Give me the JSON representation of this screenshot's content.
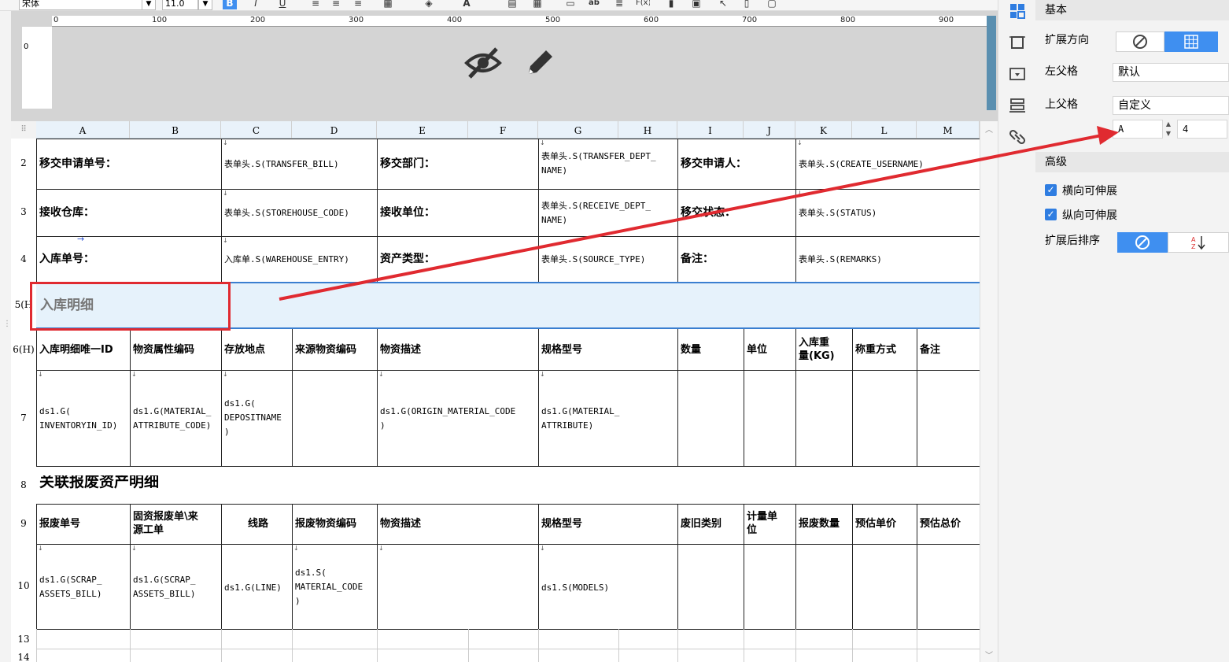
{
  "toolbar": {
    "font_name": "宋体",
    "font_size": "11.0"
  },
  "ruler": {
    "vertical_zero": "0",
    "marks": [
      "0",
      "100",
      "200",
      "300",
      "400",
      "500",
      "600",
      "700",
      "800",
      "900"
    ]
  },
  "grid": {
    "columns": [
      "A",
      "B",
      "C",
      "D",
      "E",
      "F",
      "G",
      "H",
      "I",
      "J",
      "K",
      "L",
      "M"
    ],
    "row_labels": [
      "2",
      "3",
      "4",
      "5(H",
      "6(H)",
      "7",
      "8",
      "9",
      "10",
      "13",
      "14"
    ],
    "rows": {
      "r2": {
        "a": "移交申请单号：",
        "c": "表单头.S(TRANSFER_BILL)",
        "e": "移交部门：",
        "g": "表单头.S(TRANSFER_DEPT_\nNAME)",
        "i": "移交申请人：",
        "k": "表单头.S(CREATE_USERNAME)"
      },
      "r3": {
        "a": "接收仓库：",
        "c": "表单头.S(STOREHOUSE_CODE)",
        "e": "接收单位：",
        "g": "表单头.S(RECEIVE_DEPT_\nNAME)",
        "i": "移交状态：",
        "k": "表单头.S(STATUS)"
      },
      "r4": {
        "a": "入库单号：",
        "c": "入库单.S(WAREHOUSE_ENTRY)",
        "e": "资产类型：",
        "g": "表单头.S(SOURCE_TYPE)",
        "i": "备注：",
        "k": "表单头.S(REMARKS)"
      },
      "r5": {
        "a": "入库明细"
      },
      "r6": [
        "入库明细唯一ID",
        "物资属性编码",
        "存放地点",
        "来源物资编码",
        "物资描述",
        "规格型号",
        "数量",
        "单位",
        "入库重\n量(KG)",
        "称重方式",
        "备注"
      ],
      "r7": {
        "a": "ds1.G(\nINVENTORYIN_ID)",
        "b": "ds1.G(MATERIAL_\nATTRIBUTE_CODE)",
        "c": "ds1.G(\nDEPOSITNAME\n)",
        "e": "ds1.G(ORIGIN_MATERIAL_CODE\n)",
        "g": "ds1.G(MATERIAL_\nATTRIBUTE)"
      },
      "r8": {
        "a": "关联报废资产明细"
      },
      "r9": [
        "报废单号",
        "固资报废单\\来\n源工单",
        "线路",
        "报废物资编码",
        "物资描述",
        "规格型号",
        "废旧类别",
        "计量单\n位",
        "报废数量",
        "预估单价",
        "预估总价"
      ],
      "r10": {
        "a": "ds1.G(SCRAP_\nASSETS_BILL)",
        "b": "ds1.G(SCRAP_\nASSETS_BILL)",
        "c": "ds1.G(LINE)",
        "d": "ds1.S(\nMATERIAL_CODE\n)",
        "g": "ds1.S(MODELS)"
      }
    }
  },
  "panel": {
    "basic": {
      "title": "基本",
      "expand_direction_label": "扩展方向",
      "left_parent_label": "左父格",
      "left_parent_value": "默认",
      "top_parent_label": "上父格",
      "top_parent_value": "自定义",
      "custom_col": "A",
      "custom_row": "4"
    },
    "advanced": {
      "title": "高级",
      "horizontal_expand": "横向可伸展",
      "vertical_expand": "纵向可伸展",
      "sort_after_expand": "扩展后排序"
    }
  },
  "colors": {
    "accent": "#3f8ff0",
    "annotation": "#e02a30",
    "header_band": "#d4d4d4"
  }
}
